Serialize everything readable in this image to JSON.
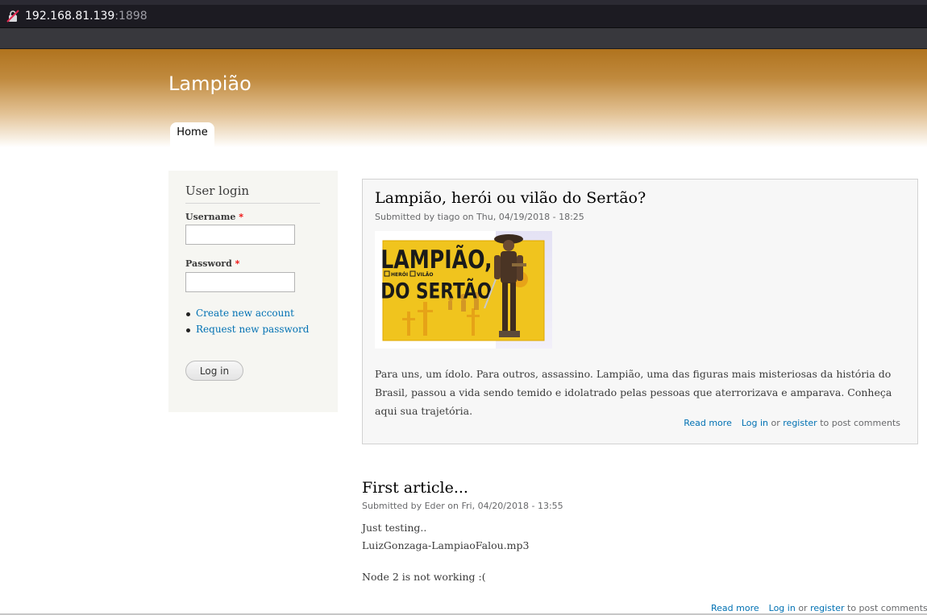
{
  "browser": {
    "url_host": "192.168.81.139",
    "url_port": ":1898",
    "icon": "insecure-lock-icon"
  },
  "site": {
    "name": "Lampião",
    "nav": [
      {
        "label": "Home",
        "active": true
      }
    ],
    "header_color": "#b0731e"
  },
  "sidebar": {
    "title": "User login",
    "username_label": "Username",
    "password_label": "Password",
    "required_mark": "*",
    "username_value": "",
    "password_value": "",
    "links": [
      "Create new account",
      "Request new password"
    ],
    "login_button": "Log in"
  },
  "nodes": [
    {
      "title": "Lampião, herói ou vilão do Sertão?",
      "submitted": "Submitted by tiago on Thu, 04/19/2018 - 18:25",
      "image": {
        "text_line1": "LAMPIÃO,",
        "opt1": "HERÓI",
        "opt2": "VILÃO",
        "text_line2": "DO SERTÃO"
      },
      "body": "Para uns, um ídolo. Para outros, assassino. Lampião, uma das figuras mais misteriosas da história do Brasil, passou a vida sendo temido e idolatrado pelas pessoas que aterrorizava e amparava. Conheça aqui sua trajetória.",
      "read_more": "Read more",
      "login": "Log in",
      "or": "or",
      "register": "register",
      "post_comments": "to post comments"
    },
    {
      "title": "First article...",
      "submitted": "Submitted by Eder on Fri, 04/20/2018 - 13:55",
      "body_lines": [
        "Just testing..",
        "LuizGonzaga-LampiaoFalou.mp3",
        "Node 2 is not working :("
      ],
      "read_more": "Read more",
      "login": "Log in",
      "or": "or",
      "register": "register",
      "post_comments": "to post comments"
    }
  ],
  "colors": {
    "link": "#0071b3",
    "sidebar_bg": "#f6f6f2",
    "node_bg": "#f7f7f7"
  }
}
